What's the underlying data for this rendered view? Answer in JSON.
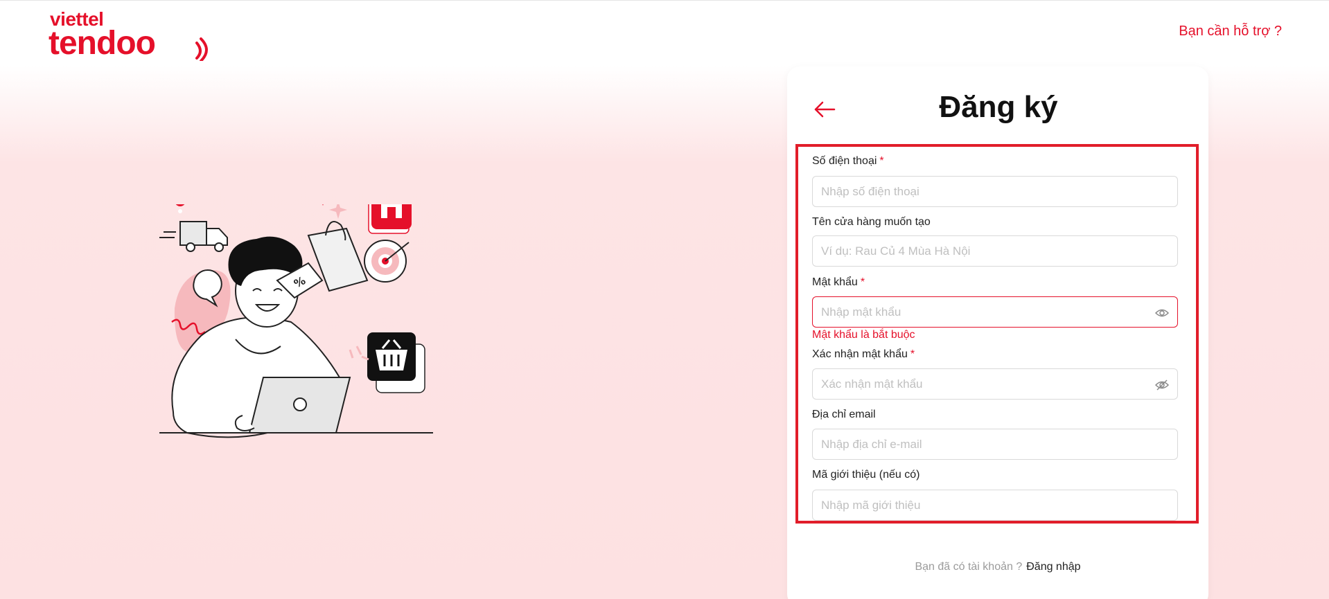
{
  "brand": {
    "top": "viettel",
    "bottom": "tendoo",
    "color": "#e5102a"
  },
  "header": {
    "help_link": "Bạn cần hỗ trợ ?"
  },
  "register": {
    "title": "Đăng ký",
    "fields": [
      {
        "label": "Số điện thoại",
        "required": "*",
        "placeholder": "Nhập số điện thoại",
        "value": ""
      },
      {
        "label": "Tên cửa hàng muốn tạo",
        "placeholder": "Ví dụ: Rau Củ 4 Mùa Hà Nội",
        "value": ""
      },
      {
        "label": "Mật khẩu",
        "required": "*",
        "placeholder": "Nhập mật khẩu",
        "value": "",
        "error": "Mật khẩu là bắt buộc"
      },
      {
        "label": "Xác nhận mật khẩu",
        "required": "*",
        "placeholder": "Xác nhận mật khẩu",
        "value": ""
      },
      {
        "label": "Địa chỉ email",
        "placeholder": "Nhập địa chỉ e-mail",
        "value": ""
      },
      {
        "label": "Mã giới thiệu (nếu có)",
        "placeholder": "Nhập mã giới thiệu",
        "value": ""
      }
    ],
    "footer_question": "Bạn đã có tài khoản ?",
    "footer_login": "Đăng nhập"
  },
  "icons": {
    "back": "arrow-left-icon",
    "password_toggle": "eye-icon",
    "confirm_toggle": "eye-off-icon"
  },
  "colors": {
    "accent": "#e5102a",
    "highlight_border": "#e11d2a",
    "background": "#fde1e2"
  }
}
